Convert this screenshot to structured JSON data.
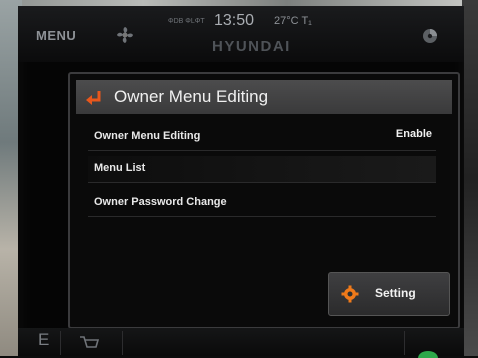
{
  "status_bar": {
    "menu_label": "MENU",
    "dab_text": "ΦDB ΦLΦT",
    "clock": "13:50",
    "temperature": "27°C",
    "temperature_suffix": "T₁",
    "brand": "HYUNDAI"
  },
  "dialog": {
    "title": "Owner Menu Editing",
    "rows": [
      {
        "label": "Owner Menu Editing",
        "value": "Enable"
      },
      {
        "label": "Menu List",
        "value": ""
      },
      {
        "label": "Owner Password Change",
        "value": ""
      }
    ],
    "setting_button_label": "Setting"
  },
  "bottom_bar": {
    "left_letter": "E"
  },
  "colors": {
    "accent_orange": "#e8571c",
    "header_gray": "#444445",
    "text_white": "#f0f0f0"
  }
}
